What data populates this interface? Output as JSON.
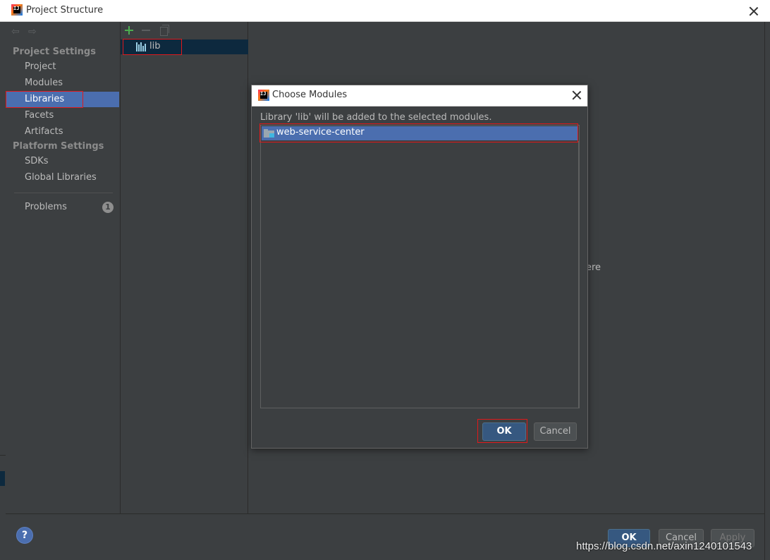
{
  "window": {
    "title": "Project Structure",
    "logo_text": "IJ"
  },
  "sidebar": {
    "project_settings_header": "Project Settings",
    "items": [
      {
        "label": "Project"
      },
      {
        "label": "Modules"
      },
      {
        "label": "Libraries",
        "selected": true
      },
      {
        "label": "Facets"
      },
      {
        "label": "Artifacts"
      }
    ],
    "platform_settings_header": "Platform Settings",
    "platform_items": [
      {
        "label": "SDKs"
      },
      {
        "label": "Global Libraries"
      }
    ],
    "problems": {
      "label": "Problems",
      "count": "1"
    }
  },
  "libraries": {
    "items": [
      {
        "label": "lib"
      }
    ]
  },
  "content": {
    "hint_fragment": "ere"
  },
  "dialog": {
    "title": "Choose Modules",
    "logo_text": "IJ",
    "message": "Library 'lib' will be added to the selected modules.",
    "modules": [
      {
        "label": "web-service-center",
        "selected": true
      }
    ],
    "ok_label": "OK",
    "cancel_label": "Cancel"
  },
  "footer": {
    "help_label": "?",
    "ok_label": "OK",
    "cancel_label": "Cancel",
    "apply_label": "Apply"
  },
  "watermark": "https://blog.csdn.net/axin1240101543",
  "colors": {
    "background": "#3c3f41",
    "selection": "#4b6eaf",
    "primary_button": "#365880",
    "highlight_box": "#e0191b",
    "add_icon": "#4caf50"
  }
}
